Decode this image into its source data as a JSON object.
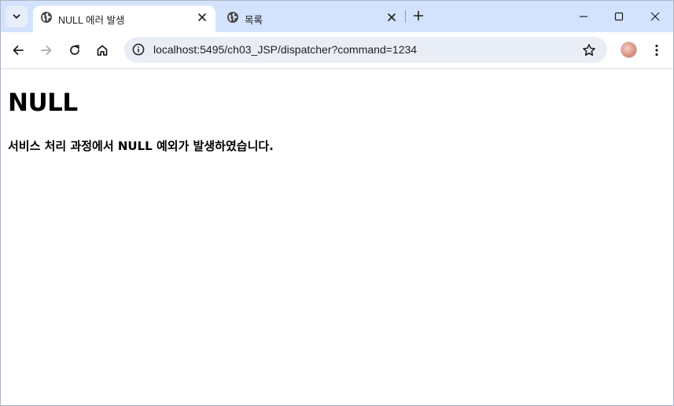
{
  "browser": {
    "tabs": [
      {
        "title": "NULL 에러 발생",
        "favicon": "globe-icon",
        "active": true
      },
      {
        "title": "목록",
        "favicon": "globe-icon",
        "active": false
      }
    ],
    "address_bar": {
      "url": "localhost:5495/ch03_JSP/dispatcher?command=1234"
    },
    "icons": {
      "tab_search": "chevron-down-icon",
      "tab_close": "close-icon",
      "new_tab": "plus-icon",
      "back": "arrow-left-icon",
      "forward": "arrow-right-icon",
      "reload": "reload-icon",
      "home": "home-icon",
      "site_info": "info-icon",
      "bookmark": "star-icon",
      "menu": "kebab-menu-icon",
      "minimize": "minimize-icon",
      "maximize": "maximize-icon",
      "close_window": "close-icon"
    },
    "colors": {
      "tabstrip": "#d3e3fd",
      "omnibox": "#e9eef6",
      "icon": "#474747",
      "forward_disabled": "#a8abb0"
    }
  },
  "page": {
    "heading": "NULL",
    "message": "서비스 처리 과정에서 NULL 예외가 발생하였습니다."
  }
}
